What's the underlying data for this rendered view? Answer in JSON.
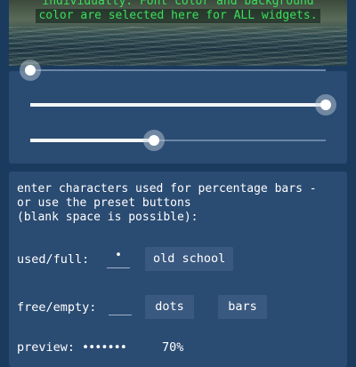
{
  "header": {
    "caption_line1": "individually. Font color and background",
    "caption_line2": "color are selected here for ALL widgets."
  },
  "sliders": [
    {
      "name": "slider-1",
      "level": 0.0
    },
    {
      "name": "slider-2",
      "level": 1.0
    },
    {
      "name": "slider-3",
      "level": 0.42
    }
  ],
  "percentage_bars": {
    "description": "enter characters used for percentage bars -\nor use the preset buttons\n(blank space is possible):",
    "used_full": {
      "label": "used/full:",
      "field_value": "•",
      "preset_button": "old school"
    },
    "free_empty": {
      "label": "free/empty:",
      "field_value": "",
      "preset_dots": "dots",
      "preset_bars": "bars"
    },
    "preview": {
      "label": "preview:",
      "bar": "•••••••",
      "percent": "70%"
    }
  },
  "colors": {
    "background": "#1b3b5e",
    "card": "#2a4b72",
    "button": "#3a5980",
    "caption_green": "#39e05a"
  }
}
